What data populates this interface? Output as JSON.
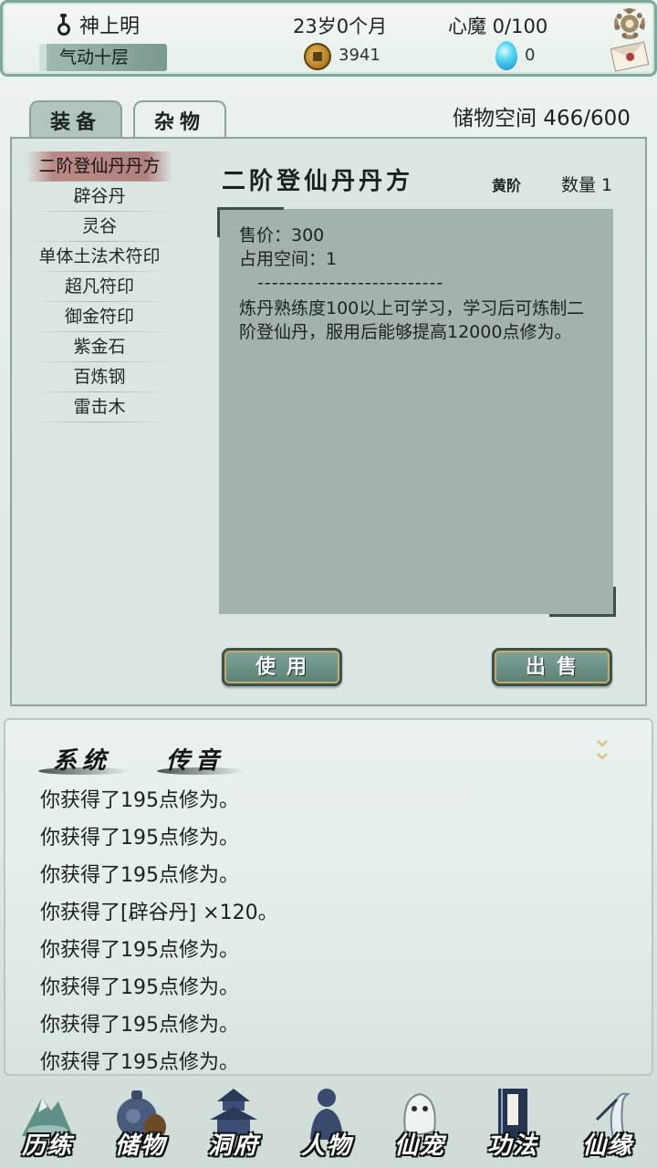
{
  "header": {
    "player_name": "神上明",
    "realm": "气动十层",
    "age": "23岁0个月",
    "heart_demon": "心魔 0/100",
    "coins": "3941",
    "gems": "0",
    "icons": [
      "male-icon",
      "coin-icon",
      "gem-icon",
      "gear-icon",
      "mail-icon"
    ]
  },
  "tabs": [
    {
      "label": "装备",
      "active": false
    },
    {
      "label": "杂物",
      "active": true
    }
  ],
  "storage": "储物空间 466/600",
  "items": [
    {
      "label": "二阶登仙丹丹方",
      "selected": true
    },
    {
      "label": "辟谷丹"
    },
    {
      "label": "灵谷"
    },
    {
      "label": "单体土法术符印"
    },
    {
      "label": "超凡符印"
    },
    {
      "label": "御金符印"
    },
    {
      "label": "紫金石"
    },
    {
      "label": "百炼钢"
    },
    {
      "label": "雷击木"
    }
  ],
  "detail": {
    "title": "二阶登仙丹丹方",
    "grade": "黄阶",
    "quantity": "数量 1",
    "price": "售价：300",
    "space": "占用空间：1",
    "separator": "--------------------------",
    "description": "炼丹熟练度100以上可学习，学习后可炼制二阶登仙丹，服用后能够提高12000点修为。"
  },
  "buttons": {
    "use": "使用",
    "sell": "出售"
  },
  "messages": {
    "tabs": [
      "系统",
      "传音"
    ],
    "lines": [
      "你获得了195点修为。",
      "你获得了195点修为。",
      "你获得了195点修为。",
      "你获得了[辟谷丹] ×120。",
      "你获得了195点修为。",
      "你获得了195点修为。",
      "你获得了195点修为。",
      "你获得了195点修为。"
    ]
  },
  "nav": [
    {
      "label": "历练",
      "icon": "mountain-icon"
    },
    {
      "label": "储物",
      "icon": "gourd-bag-icon"
    },
    {
      "label": "洞府",
      "icon": "pagoda-icon"
    },
    {
      "label": "人物",
      "icon": "person-silhouette-icon"
    },
    {
      "label": "仙宠",
      "icon": "spirit-pet-icon"
    },
    {
      "label": "功法",
      "icon": "scroll-book-icon"
    },
    {
      "label": "仙缘",
      "icon": "crane-icon"
    }
  ],
  "colors": {
    "panel": "#dbe6e2",
    "selected_item": "#b07a78",
    "button": "#6f948a",
    "gold_accent": "#c9a96b"
  }
}
